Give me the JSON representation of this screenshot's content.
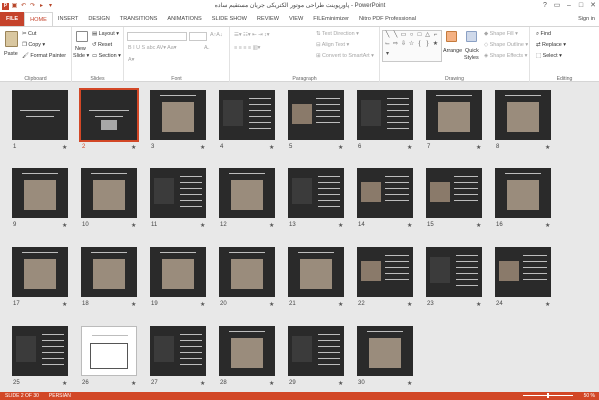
{
  "window": {
    "title": "پاورپوینت طراحی موتور الکتریکی جریان مستقیم ساده - PowerPoint",
    "controls": [
      "?",
      "▭",
      "–",
      "□",
      "✕"
    ]
  },
  "tabs": [
    "FILE",
    "HOME",
    "INSERT",
    "DESIGN",
    "TRANSITIONS",
    "ANIMATIONS",
    "SLIDE SHOW",
    "REVIEW",
    "VIEW",
    "FILEminimizer",
    "Nitro PDF Professional"
  ],
  "active_tab": "HOME",
  "signin": "Sign in",
  "ribbon": {
    "clipboard": {
      "label": "Clipboard",
      "paste": "Paste",
      "cut": "Cut",
      "copy": "Copy",
      "format_painter": "Format Painter"
    },
    "slides": {
      "label": "Slides",
      "new_slide": "New",
      "new_slide2": "Slide",
      "layout": "Layout",
      "reset": "Reset",
      "section": "Section"
    },
    "font": {
      "label": "Font"
    },
    "paragraph": {
      "label": "Paragraph",
      "text_direction": "Text Direction",
      "align_text": "Align Text",
      "convert": "Convert to SmartArt"
    },
    "drawing": {
      "label": "Drawing",
      "arrange": "Arrange",
      "quick_styles": "Quick",
      "quick_styles2": "Styles",
      "shape_fill": "Shape Fill",
      "shape_outline": "Shape Outline",
      "shape_effects": "Shape Effects"
    },
    "editing": {
      "label": "Editing",
      "find": "Find",
      "replace": "Replace",
      "select": "Select"
    }
  },
  "slides": [
    {
      "n": "1"
    },
    {
      "n": "2"
    },
    {
      "n": "3"
    },
    {
      "n": "4"
    },
    {
      "n": "5"
    },
    {
      "n": "6"
    },
    {
      "n": "7"
    },
    {
      "n": "8"
    },
    {
      "n": "9"
    },
    {
      "n": "10"
    },
    {
      "n": "11"
    },
    {
      "n": "12"
    },
    {
      "n": "13"
    },
    {
      "n": "14"
    },
    {
      "n": "15"
    },
    {
      "n": "16"
    },
    {
      "n": "17"
    },
    {
      "n": "18"
    },
    {
      "n": "19"
    },
    {
      "n": "20"
    },
    {
      "n": "21"
    },
    {
      "n": "22"
    },
    {
      "n": "23"
    },
    {
      "n": "24"
    },
    {
      "n": "25"
    },
    {
      "n": "26"
    },
    {
      "n": "27"
    },
    {
      "n": "28"
    },
    {
      "n": "29"
    },
    {
      "n": "30"
    }
  ],
  "selected_slide": 2,
  "star_glyph": "★",
  "status": {
    "slide": "SLIDE 2 OF 30",
    "language": "PERSIAN",
    "zoom": "50 %"
  },
  "colors": {
    "accent": "#d24726",
    "thumb_bg": "#2a2a2a"
  }
}
